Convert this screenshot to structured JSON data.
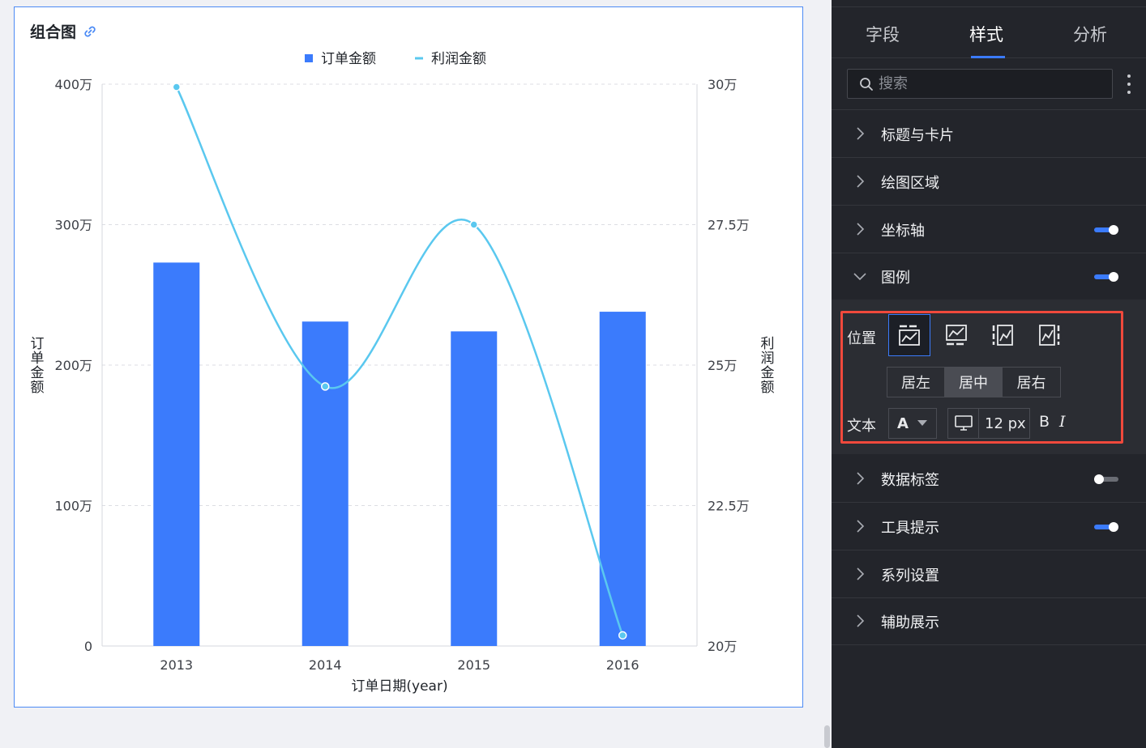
{
  "card": {
    "title": "组合图"
  },
  "chart_data": {
    "type": "bar",
    "title": "组合图",
    "categories": [
      "2013",
      "2014",
      "2015",
      "2016"
    ],
    "series": [
      {
        "name": "订单金额",
        "type": "bar",
        "axis": "left",
        "values": [
          2730000,
          2310000,
          2240000,
          2380000
        ],
        "color": "#3b7bfc"
      },
      {
        "name": "利润金额",
        "type": "line",
        "axis": "right",
        "values": [
          299500,
          246200,
          275000,
          201900
        ],
        "color": "#5ac8ef"
      }
    ],
    "xlabel": "订单日期(year)",
    "ylabel": "订单金额",
    "y2label": "利润金额",
    "ylim": [
      0,
      4000000
    ],
    "y2lim": [
      200000,
      300000
    ],
    "yticks": [
      "0",
      "100万",
      "200万",
      "300万",
      "400万"
    ],
    "y2ticks": [
      "20万",
      "22.5万",
      "25万",
      "27.5万",
      "30万"
    ],
    "grid": true,
    "legend": "top-center"
  },
  "panel": {
    "tabs": [
      "字段",
      "样式",
      "分析"
    ],
    "active_tab": "样式",
    "search_placeholder": "搜索",
    "sections_top": [
      {
        "label": "标题与卡片",
        "toggle": null
      },
      {
        "label": "绘图区域",
        "toggle": null
      },
      {
        "label": "坐标轴",
        "toggle": "on"
      },
      {
        "label": "图例",
        "toggle": "on",
        "expanded": true
      }
    ],
    "legend_settings": {
      "position_label": "位置",
      "align_options": [
        "居左",
        "居中",
        "居右"
      ],
      "align_selected": "居中",
      "text_label": "文本",
      "font_color_letter": "A",
      "font_size": "12 px",
      "bold": "B",
      "italic": "I"
    },
    "sections_bottom": [
      {
        "label": "数据标签",
        "toggle": "off"
      },
      {
        "label": "工具提示",
        "toggle": "on"
      },
      {
        "label": "系列设置",
        "toggle": null
      },
      {
        "label": "辅助展示",
        "toggle": null
      }
    ]
  },
  "colors": {
    "accent": "#3b7bfc",
    "line": "#5ac8ef",
    "highlight": "#f0493c",
    "panel_bg": "#23252b"
  }
}
